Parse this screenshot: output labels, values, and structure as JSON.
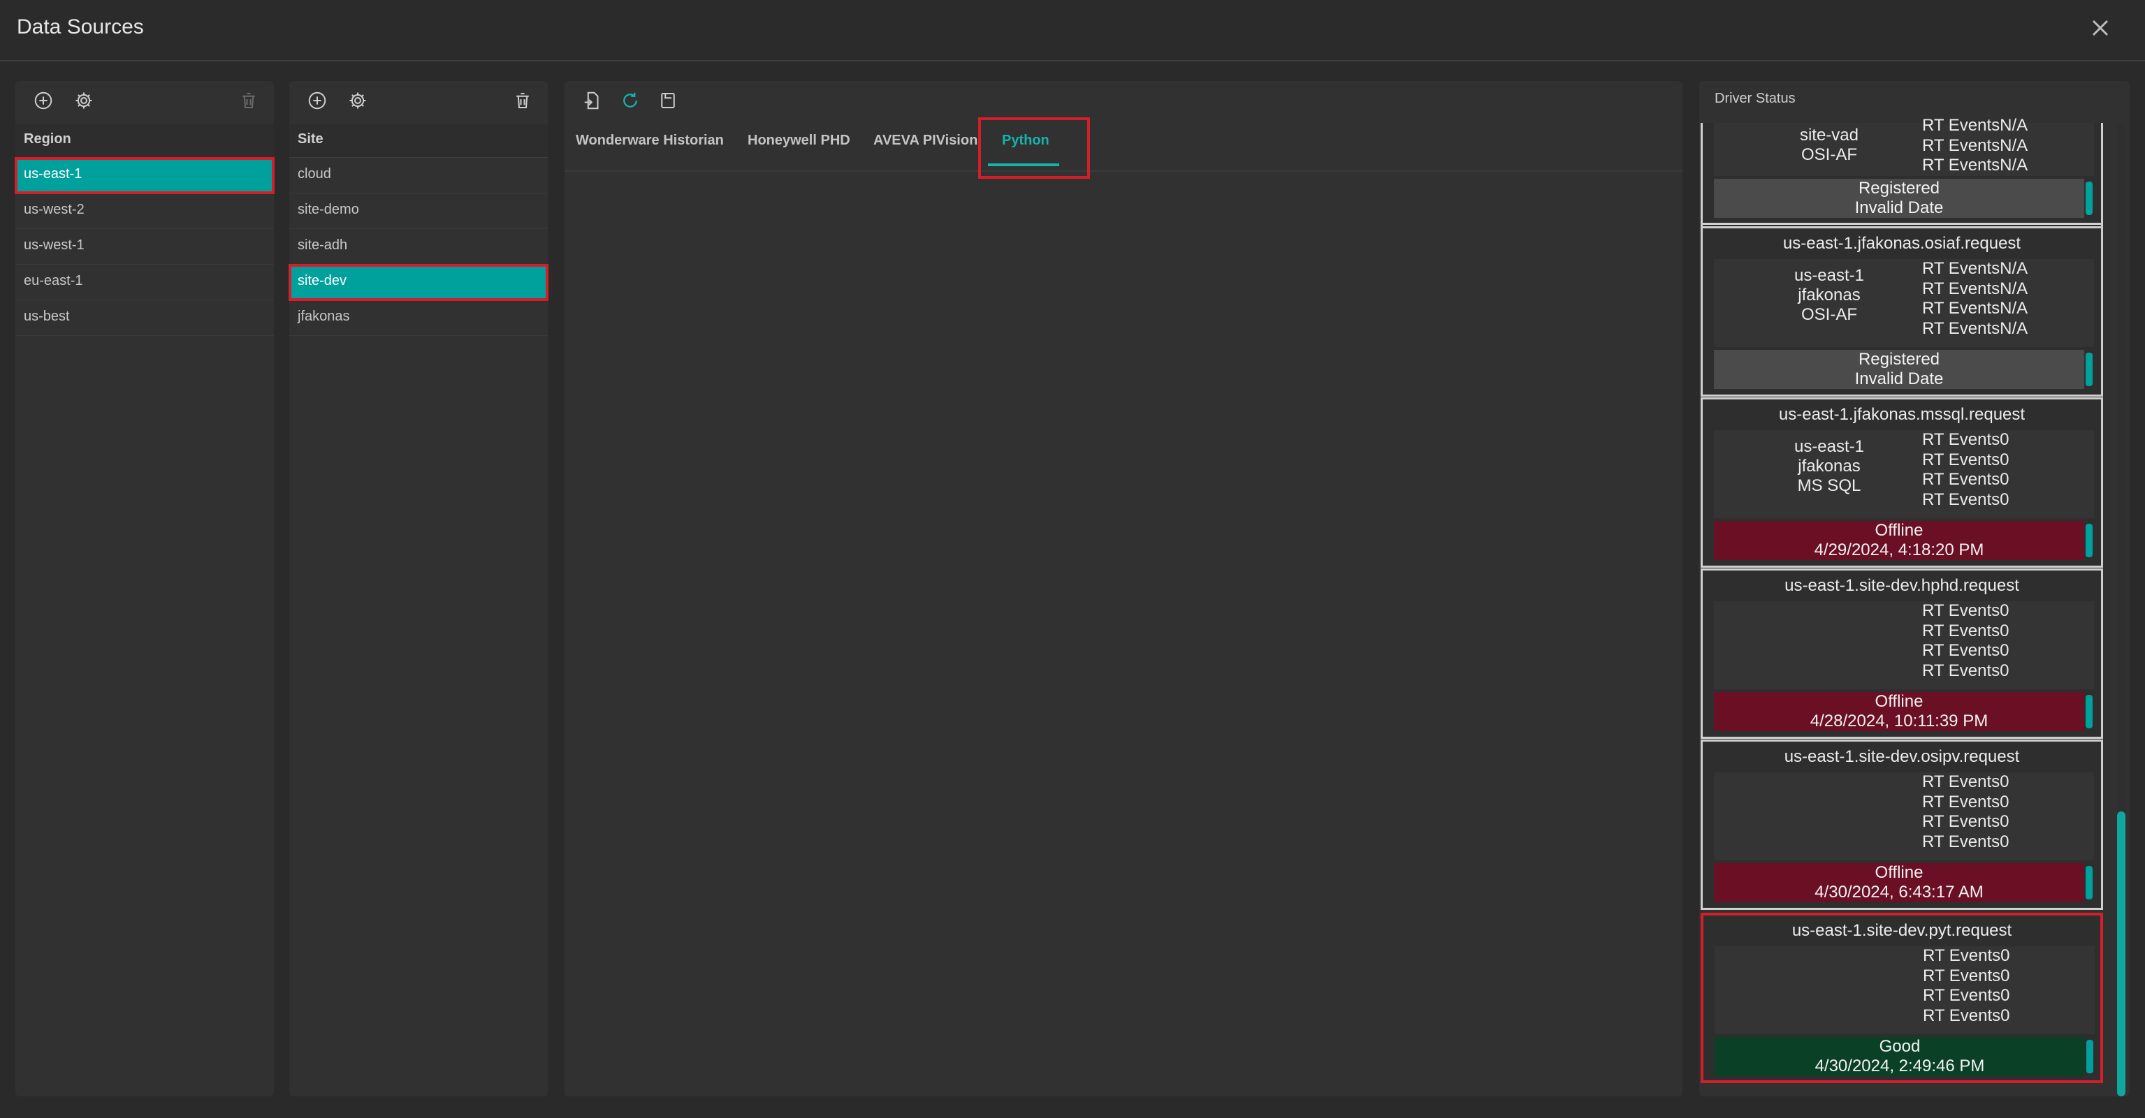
{
  "window": {
    "title": "Data Sources"
  },
  "region_panel": {
    "header": "Region",
    "items": [
      "us-east-1",
      "us-west-2",
      "us-west-1",
      "eu-east-1",
      "us-best"
    ],
    "selected": "us-east-1"
  },
  "site_panel": {
    "header": "Site",
    "items": [
      "cloud",
      "site-demo",
      "site-adh",
      "site-dev",
      "jfakonas"
    ],
    "selected": "site-dev"
  },
  "main_panel": {
    "tabs": [
      "Wonderware Historian",
      "Honeywell PHD",
      "AVEVA PIVision",
      "Python"
    ],
    "active_tab": "Python"
  },
  "driver_status": {
    "header": "Driver Status",
    "rt_label": "RT Events",
    "cards": [
      {
        "title": "",
        "meta": [
          "site-vad",
          "OSI-AF"
        ],
        "rt": [
          "N/A",
          "N/A",
          "N/A"
        ],
        "status": "Registered",
        "date": "Invalid Date",
        "kind": "registered"
      },
      {
        "title": "us-east-1.jfakonas.osiaf.request",
        "meta": [
          "us-east-1",
          "jfakonas",
          "OSI-AF"
        ],
        "rt": [
          "N/A",
          "N/A",
          "N/A",
          "N/A"
        ],
        "status": "Registered",
        "date": "Invalid Date",
        "kind": "registered"
      },
      {
        "title": "us-east-1.jfakonas.mssql.request",
        "meta": [
          "us-east-1",
          "jfakonas",
          "MS SQL"
        ],
        "rt": [
          "0",
          "0",
          "0",
          "0"
        ],
        "status": "Offline",
        "date": "4/29/2024, 4:18:20 PM",
        "kind": "offline"
      },
      {
        "title": "us-east-1.site-dev.hphd.request",
        "meta": [],
        "rt": [
          "0",
          "0",
          "0",
          "0"
        ],
        "status": "Offline",
        "date": "4/28/2024, 10:11:39 PM",
        "kind": "offline"
      },
      {
        "title": "us-east-1.site-dev.osipv.request",
        "meta": [],
        "rt": [
          "0",
          "0",
          "0",
          "0"
        ],
        "status": "Offline",
        "date": "4/30/2024, 6:43:17 AM",
        "kind": "offline"
      },
      {
        "title": "us-east-1.site-dev.pyt.request",
        "meta": [],
        "rt": [
          "0",
          "0",
          "0",
          "0"
        ],
        "status": "Good",
        "date": "4/30/2024, 2:49:46 PM",
        "kind": "good"
      }
    ]
  },
  "icons": {
    "add": "add-circle-icon",
    "settings": "gear-icon",
    "delete": "trash-icon",
    "close": "close-icon",
    "export": "file-export-icon",
    "refresh": "refresh-icon",
    "save": "save-icon"
  },
  "colors": {
    "accent": "#00a19c",
    "offline": "#6b0f24",
    "good": "#0a4026",
    "registered": "#4b4b4b",
    "highlight": "#d41e2a"
  }
}
